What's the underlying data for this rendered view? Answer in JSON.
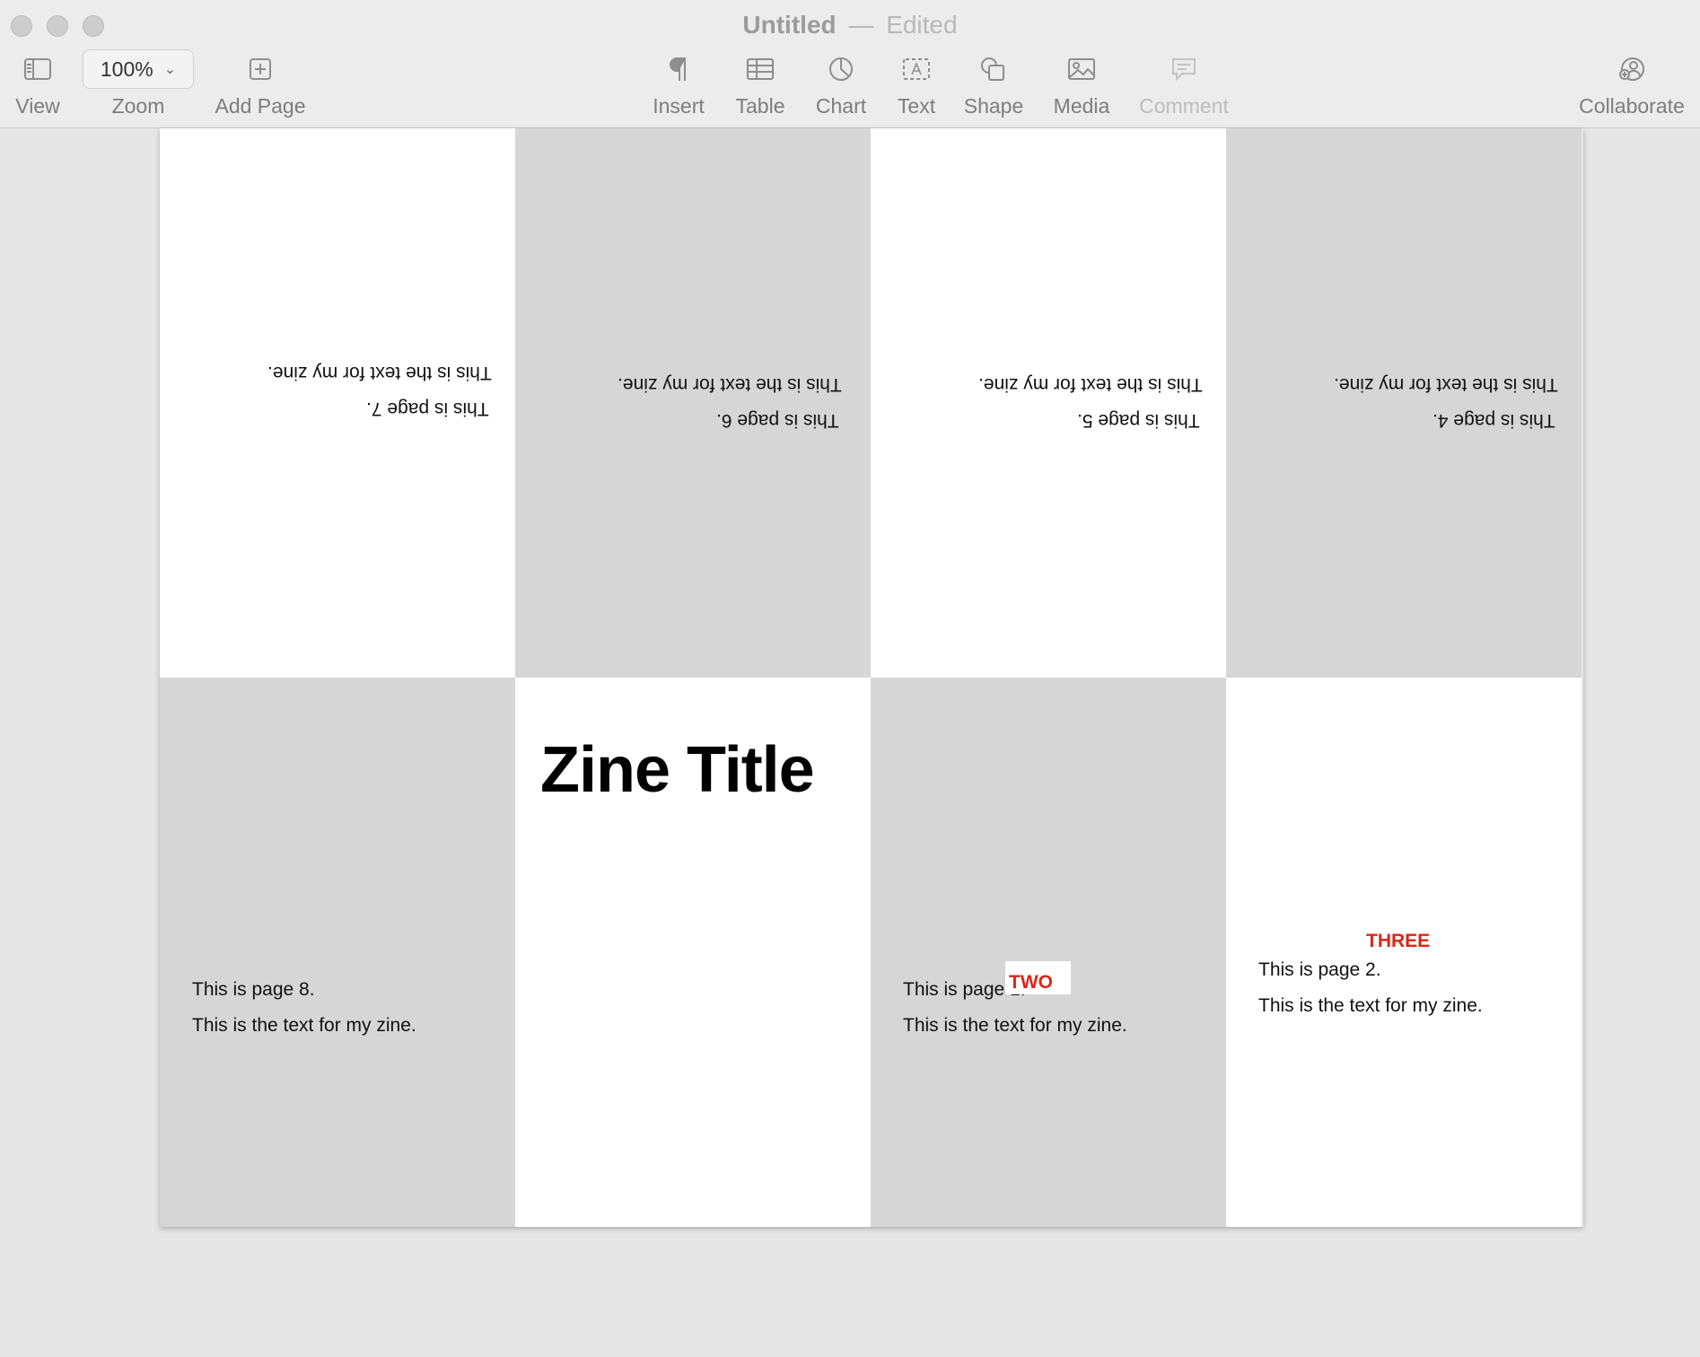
{
  "window": {
    "title": "Untitled",
    "separator": "—",
    "status": "Edited"
  },
  "toolbar": {
    "view_label": "View",
    "zoom_value": "100%",
    "zoom_label": "Zoom",
    "add_page_label": "Add Page",
    "insert_label": "Insert",
    "table_label": "Table",
    "chart_label": "Chart",
    "text_label": "Text",
    "shape_label": "Shape",
    "media_label": "Media",
    "comment_label": "Comment",
    "collaborate_label": "Collaborate"
  },
  "icons": {
    "view": "sidebar-icon",
    "zoom": "chevron-down-icon",
    "add_page": "plus-square-icon",
    "insert": "pilcrow-icon",
    "table": "table-icon",
    "chart": "pie-chart-icon",
    "text": "text-box-icon",
    "shape": "shape-icon",
    "media": "image-icon",
    "comment": "speech-bubble-icon",
    "collaborate": "add-person-icon"
  },
  "panels": {
    "page7": {
      "line1": "This is page 7.",
      "line2": "This is the text for my zine."
    },
    "page6": {
      "line1": "This is page 6.",
      "line2": "This is the text for my zine."
    },
    "page5": {
      "line1": "This is page 5.",
      "line2": "This is the text for my zine."
    },
    "page4": {
      "line1": "This is page 4.",
      "line2": "This is the text for my zine."
    },
    "page8": {
      "line1": "This is page 8.",
      "line2": "This is the text for my zine."
    },
    "cover": {
      "title": "Zine Title"
    },
    "page1": {
      "line1": "This is page 1.",
      "line2": "This is the text for my zine.",
      "label": "TWO"
    },
    "page2": {
      "line1": "This is page 2.",
      "line2": "This is the text for my zine.",
      "label": "THREE"
    }
  },
  "colors": {
    "gray_panel": "#d6d6d6",
    "white_panel": "#ffffff",
    "accent_red": "#d9271c"
  }
}
